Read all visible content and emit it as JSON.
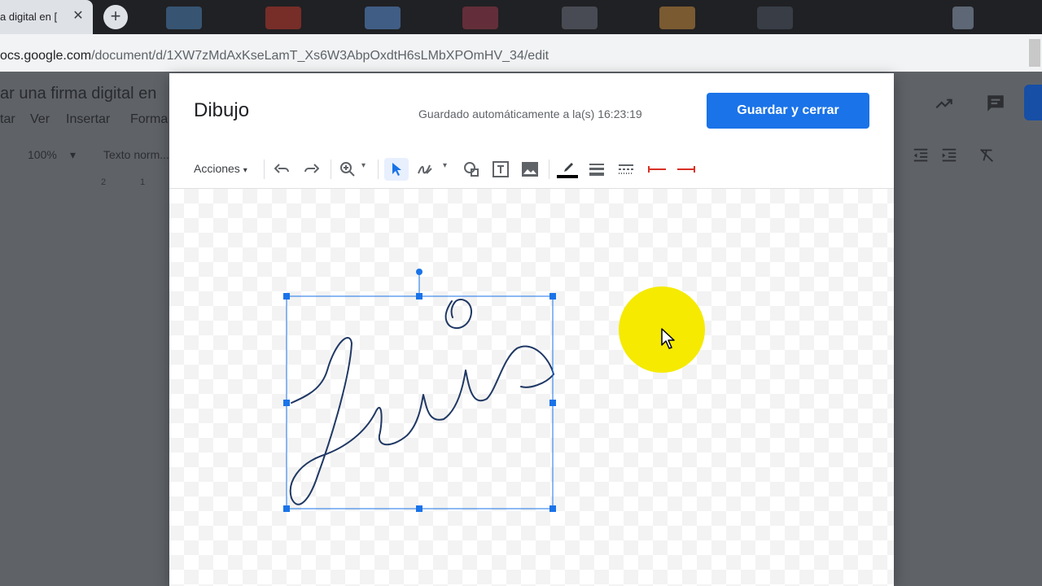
{
  "browser": {
    "tab_title": "a digital en [",
    "tab_close": "✕",
    "new_tab": "+",
    "url_host": "ocs.google.com",
    "url_path": "/document/d/1XW7zMdAxKseLamT_Xs6W3AbpOxdtH6sLMbXPOmHV_34/edit"
  },
  "docs": {
    "title": "ar una firma digital en",
    "menus": [
      "tar",
      "Ver",
      "Insertar",
      "Forma"
    ],
    "zoom": "100%",
    "style": "Texto norm...",
    "ruler": [
      "2",
      "1"
    ]
  },
  "dialog": {
    "title": "Dibujo",
    "saved_status": "Guardado automáticamente a la(s) 16:23:19",
    "save_button": "Guardar y cerrar",
    "actions_menu": "Acciones",
    "drop_arrow": "▾"
  },
  "colors": {
    "accent": "#1a73e8",
    "signature_stroke": "#1f3864",
    "selection": "#1a73e8",
    "cursor_highlight": "#f5ea00"
  },
  "icons": [
    "undo-icon",
    "redo-icon",
    "zoom-icon",
    "select-icon",
    "line-tool-icon",
    "shape-icon",
    "textbox-icon",
    "image-icon",
    "line-color-icon",
    "line-weight-icon",
    "line-dash-icon",
    "line-start-icon",
    "line-end-icon",
    "trending-icon",
    "comment-icon",
    "indent-decrease-icon",
    "indent-increase-icon",
    "clear-format-icon",
    "mouse-cursor-icon"
  ]
}
